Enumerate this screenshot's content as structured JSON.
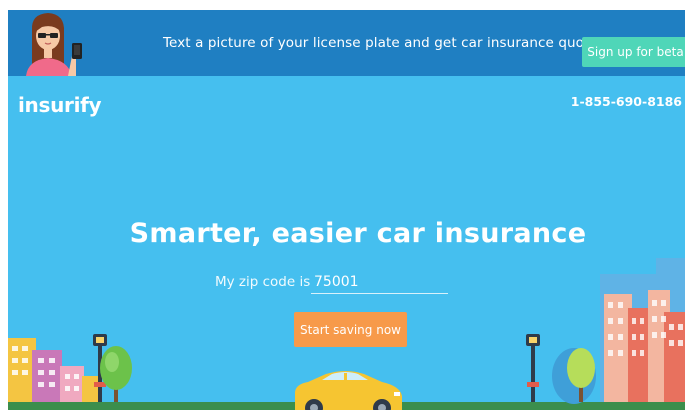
{
  "banner": {
    "message": "Text a picture of your license plate and get car insurance quotes fast",
    "cta_label": "Sign up for beta",
    "background_color": "#1f7fc2",
    "cta_color": "#4fd6b8"
  },
  "header": {
    "logo_text": "insurify",
    "phone": "1-855-690-8186"
  },
  "hero": {
    "headline": "Smarter, easier car insurance",
    "zip_label": "My zip code is",
    "zip_value": "75001",
    "cta_label": "Start saving now",
    "background_color": "#45bfef",
    "cta_color": "#f79a4a"
  },
  "illustration": {
    "icons": [
      "girl-with-phone-icon",
      "street-lamp-icon",
      "tree-icon",
      "yellow-car-icon",
      "city-buildings-icon"
    ]
  }
}
